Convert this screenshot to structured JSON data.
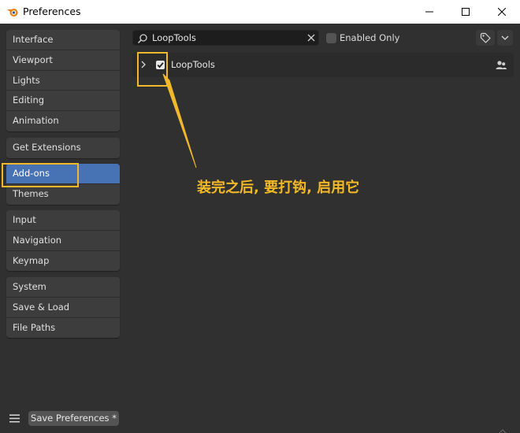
{
  "window": {
    "title": "Preferences"
  },
  "sidebar": {
    "groups": [
      {
        "items": [
          {
            "label": "Interface"
          },
          {
            "label": "Viewport"
          },
          {
            "label": "Lights"
          },
          {
            "label": "Editing"
          },
          {
            "label": "Animation"
          }
        ]
      },
      {
        "items": [
          {
            "label": "Get Extensions"
          }
        ]
      },
      {
        "items": [
          {
            "label": "Add-ons",
            "active": true
          },
          {
            "label": "Themes"
          }
        ]
      },
      {
        "items": [
          {
            "label": "Input"
          },
          {
            "label": "Navigation"
          },
          {
            "label": "Keymap"
          }
        ]
      },
      {
        "items": [
          {
            "label": "System"
          },
          {
            "label": "Save & Load"
          },
          {
            "label": "File Paths"
          }
        ]
      }
    ]
  },
  "search": {
    "value": "LoopTools"
  },
  "filter": {
    "enabled_only_label": "Enabled Only",
    "enabled_only_checked": false
  },
  "addon": {
    "name": "LoopTools",
    "enabled": true
  },
  "annotation": {
    "note": "装完之后, 要打钩, 启用它",
    "color": "#f5b925"
  },
  "footer": {
    "save_label": "Save Preferences *"
  },
  "colors": {
    "accent": "#4772b3",
    "background": "#303030",
    "highlight": "#f0b82a"
  },
  "icons": {
    "app": "blender-logo-icon",
    "search": "search-icon",
    "clear": "close-icon",
    "tag": "tag-icon",
    "dropdown": "chevron-down-icon",
    "expand": "chevron-right-icon",
    "users": "users-icon",
    "menu": "hamburger-menu-icon"
  }
}
